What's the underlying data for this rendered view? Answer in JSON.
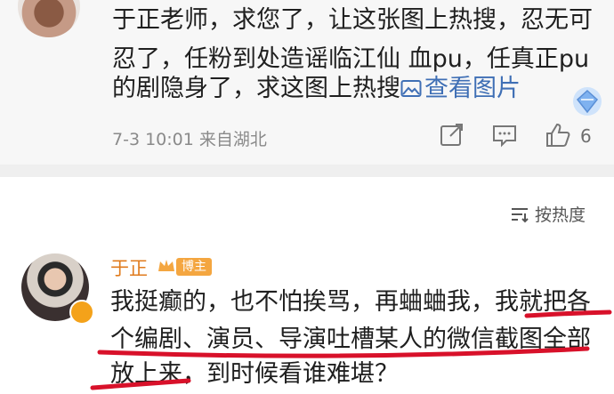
{
  "top_post": {
    "lines": [
      "于正老师，求您了，让这张图上热搜，忍无可",
      "忍了，任粉到处造谣临江仙 血pu，任真正pu",
      "的剧隐身了，求这图上热搜"
    ],
    "view_image_label": "查看图片",
    "meta": "7-3 10:01 来自湖北",
    "like_count": "6"
  },
  "sort": {
    "label": "按热度"
  },
  "reply": {
    "author": "于正",
    "badge": "博主",
    "lines": [
      "我挺癫的，也不怕挨骂，再蛐蛐我，我就把各",
      "个编剧、演员、导演吐槽某人的微信截图全部",
      "放上来，到时候看谁难堪？"
    ]
  },
  "colors": {
    "link": "#3f6fb5",
    "author": "#e07b1d",
    "badge": "#f4a640",
    "underline": "#d8112a"
  }
}
